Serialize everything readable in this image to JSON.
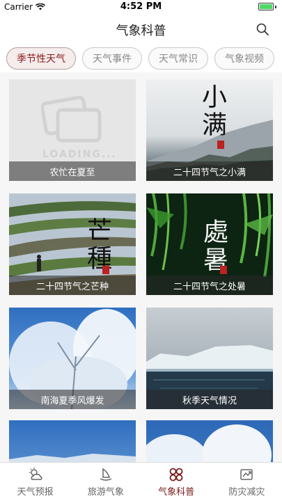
{
  "status": {
    "carrier": "Carrier",
    "time": "4:52 PM"
  },
  "nav": {
    "title": "气象科普"
  },
  "tabs": [
    {
      "label": "季节性天气",
      "active": true
    },
    {
      "label": "天气事件",
      "active": false
    },
    {
      "label": "天气常识",
      "active": false
    },
    {
      "label": "气象视频",
      "active": false
    }
  ],
  "cards": [
    {
      "caption": "农忙在夏至",
      "loading_text": "LOADING..."
    },
    {
      "caption": "二十四节气之小满",
      "calligraphy": "小满"
    },
    {
      "caption": "二十四节气之芒种",
      "calligraphy": "芒種"
    },
    {
      "caption": "二十四节气之处暑",
      "calligraphy": "處暑"
    },
    {
      "caption": "南海夏季风爆发"
    },
    {
      "caption": "秋季天气情况"
    },
    {
      "caption": ""
    },
    {
      "caption": ""
    }
  ],
  "bottom_tabs": [
    {
      "label": "天气预报",
      "icon": "sun-cloud-icon",
      "active": false
    },
    {
      "label": "旅游气象",
      "icon": "sail-icon",
      "active": false
    },
    {
      "label": "气象科普",
      "icon": "grid-flower-icon",
      "active": true
    },
    {
      "label": "防灾减灾",
      "icon": "disaster-icon",
      "active": false
    }
  ],
  "colors": {
    "accent": "#7a1c1c",
    "battery": "#4cd964"
  }
}
